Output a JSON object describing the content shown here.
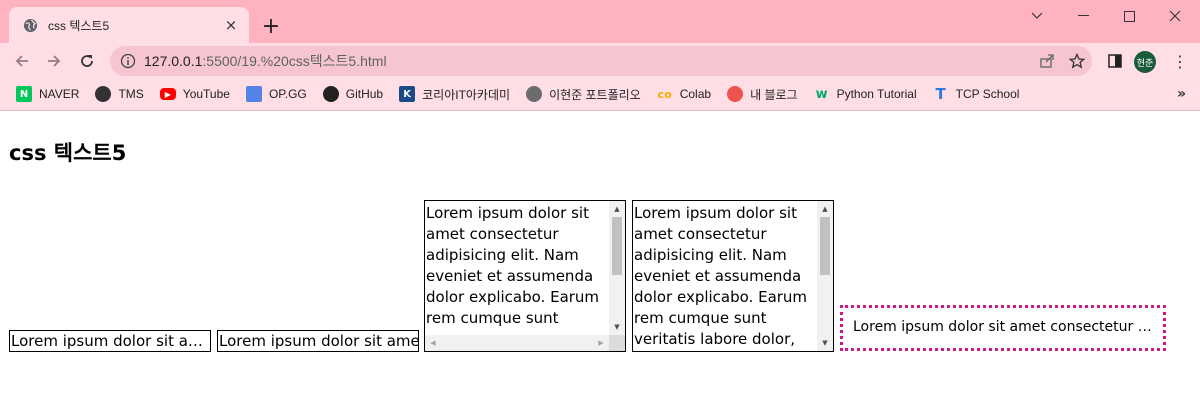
{
  "browser": {
    "tab_title": "css 텍스트5",
    "tab_close": "×",
    "new_tab": "+",
    "url_host": "127.0.0.1",
    "url_path": ":5500/19.%20css텍스트5.html",
    "avatar_text": "현준",
    "menu": "⋮",
    "bookmarks_more": "»",
    "bookmarks": [
      {
        "label": "NAVER",
        "icon": "naver-icon",
        "color": "#03c75a",
        "glyph": "N"
      },
      {
        "label": "TMS",
        "icon": "globe-icon",
        "color": "#333333",
        "glyph": ""
      },
      {
        "label": "YouTube",
        "icon": "youtube-icon",
        "color": "#ff0000",
        "glyph": "▶"
      },
      {
        "label": "OP.GG",
        "icon": "opgg-icon",
        "color": "#5383e8",
        "glyph": ""
      },
      {
        "label": "GitHub",
        "icon": "github-icon",
        "color": "#222222",
        "glyph": ""
      },
      {
        "label": "코리아IT아카데미",
        "icon": "koreait-icon",
        "color": "#1a4a8a",
        "glyph": "K"
      },
      {
        "label": "이현준 포트폴리오",
        "icon": "portfolio-icon",
        "color": "#444444",
        "glyph": ""
      },
      {
        "label": "Colab",
        "icon": "colab-icon",
        "color": "#f9ab00",
        "glyph": "co"
      },
      {
        "label": "내 블로그",
        "icon": "blog-icon",
        "color": "#ef5350",
        "glyph": ""
      },
      {
        "label": "Python Tutorial",
        "icon": "w3schools-icon",
        "color": "#04aa6d",
        "glyph": "w"
      },
      {
        "label": "TCP School",
        "icon": "tcpschool-icon",
        "color": "#2a7be4",
        "glyph": "T"
      }
    ]
  },
  "page": {
    "heading": "css 텍스트5",
    "box1_text": "Lorem ipsum dolor sit amet consectetur adipisicing elit.",
    "box2_text": "Lorem ipsum dolor sit amet consectetur adipisicing elit.",
    "box3_text": "Lorem ipsum dolor sit amet consectetur adipisicing elit. Nam eveniet et assumenda dolor explicabo. Earum rem cumque sunt veritatis labore dolor,",
    "box4_text": "Lorem ipsum dolor sit amet consectetur adipisicing elit. Nam eveniet et assumenda dolor explicabo. Earum rem cumque sunt veritatis labore dolor,",
    "box5_text": "Lorem ipsum dolor sit amet consectetur adipisicing elit."
  }
}
